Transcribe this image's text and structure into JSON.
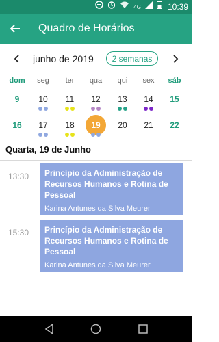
{
  "status_bar": {
    "network": "4G",
    "time": "10:39"
  },
  "app_bar": {
    "title": "Quadro de Horários"
  },
  "calendar": {
    "month_label": "junho de 2019",
    "view_toggle_label": "2 semanas",
    "weekdays": [
      "dom",
      "seg",
      "ter",
      "qua",
      "qui",
      "sex",
      "sáb"
    ],
    "weeks": [
      [
        {
          "day": "9",
          "dots": []
        },
        {
          "day": "10",
          "dots": [
            "#90a8e0",
            "#90a8e0"
          ]
        },
        {
          "day": "11",
          "dots": [
            "#e7e31b",
            "#e7e31b"
          ]
        },
        {
          "day": "12",
          "dots": [
            "#b486c4",
            "#b486c4"
          ]
        },
        {
          "day": "13",
          "dots": [
            "#27a389",
            "#27a389"
          ]
        },
        {
          "day": "14",
          "dots": [
            "#7c26c8",
            "#7c26c8"
          ]
        },
        {
          "day": "15",
          "dots": []
        }
      ],
      [
        {
          "day": "16",
          "dots": []
        },
        {
          "day": "17",
          "dots": [
            "#90a8e0",
            "#90a8e0"
          ]
        },
        {
          "day": "18",
          "dots": [
            "#e7e31b",
            "#e7e31b"
          ]
        },
        {
          "day": "19",
          "dots": [
            "#90a8e0",
            "#90a8e0"
          ],
          "today": true
        },
        {
          "day": "20",
          "dots": []
        },
        {
          "day": "21",
          "dots": []
        },
        {
          "day": "22",
          "dots": []
        }
      ]
    ]
  },
  "selected_date": "Quarta, 19 de Junho",
  "events": [
    {
      "time": "13:30",
      "title": "Princípio da Administração de Recursos Humanos e Rotina de Pessoal",
      "teacher": "Karina Antunes da Silva Meurer"
    },
    {
      "time": "15:30",
      "title": "Princípio da Administração de Recursos Humanos e Rotina de Pessoal",
      "teacher": "Karina Antunes da Silva Meurer"
    }
  ],
  "colors": {
    "primary": "#26a383",
    "status_bar": "#1b8a6b",
    "today": "#f3a736",
    "event_card": "#8ea6e0"
  }
}
